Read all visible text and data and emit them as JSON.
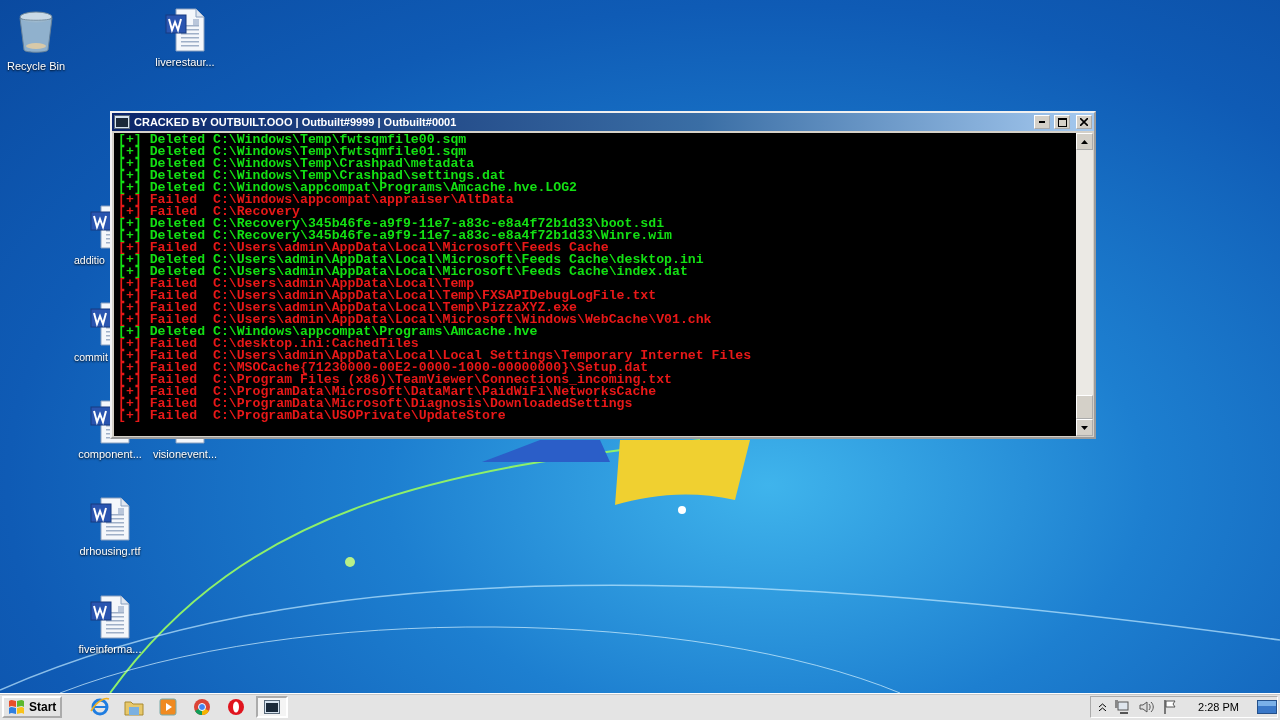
{
  "desktop": {
    "icons": [
      {
        "label": "Recycle Bin",
        "kind": "recycle-bin"
      },
      {
        "label": "liverestaur...",
        "kind": "document"
      },
      {
        "label": "additio",
        "kind": "document"
      },
      {
        "label": "commit",
        "kind": "document"
      },
      {
        "label": "component...",
        "kind": "document"
      },
      {
        "label": "visionevent...",
        "kind": "document"
      },
      {
        "label": "drhousing.rtf",
        "kind": "document"
      },
      {
        "label": "fiveinforma...",
        "kind": "document"
      }
    ]
  },
  "console_window": {
    "title": "CRACKED BY OUTBUILT.OOO | Outbuilt#9999 | Outbuilt#0001",
    "lines": [
      {
        "kind": "deleted",
        "text": "[+] Deleted C:\\Windows\\Temp\\fwtsqmfile00.sqm"
      },
      {
        "kind": "deleted",
        "text": "[+] Deleted C:\\Windows\\Temp\\fwtsqmfile01.sqm"
      },
      {
        "kind": "deleted",
        "text": "[+] Deleted C:\\Windows\\Temp\\Crashpad\\metadata"
      },
      {
        "kind": "deleted",
        "text": "[+] Deleted C:\\Windows\\Temp\\Crashpad\\settings.dat"
      },
      {
        "kind": "deleted",
        "text": "[+] Deleted C:\\Windows\\appcompat\\Programs\\Amcache.hve.LOG2"
      },
      {
        "kind": "failed",
        "text": "[+] Failed  C:\\Windows\\appcompat\\appraiser\\AltData"
      },
      {
        "kind": "failed",
        "text": "[+] Failed  C:\\Recovery"
      },
      {
        "kind": "deleted",
        "text": "[+] Deleted C:\\Recovery\\345b46fe-a9f9-11e7-a83c-e8a4f72b1d33\\boot.sdi"
      },
      {
        "kind": "deleted",
        "text": "[+] Deleted C:\\Recovery\\345b46fe-a9f9-11e7-a83c-e8a4f72b1d33\\Winre.wim"
      },
      {
        "kind": "failed",
        "text": "[+] Failed  C:\\Users\\admin\\AppData\\Local\\Microsoft\\Feeds Cache"
      },
      {
        "kind": "deleted",
        "text": "[+] Deleted C:\\Users\\admin\\AppData\\Local\\Microsoft\\Feeds Cache\\desktop.ini"
      },
      {
        "kind": "deleted",
        "text": "[+] Deleted C:\\Users\\admin\\AppData\\Local\\Microsoft\\Feeds Cache\\index.dat"
      },
      {
        "kind": "failed",
        "text": "[+] Failed  C:\\Users\\admin\\AppData\\Local\\Temp"
      },
      {
        "kind": "failed",
        "text": "[+] Failed  C:\\Users\\admin\\AppData\\Local\\Temp\\FXSAPIDebugLogFile.txt"
      },
      {
        "kind": "failed",
        "text": "[+] Failed  C:\\Users\\admin\\AppData\\Local\\Temp\\PizzaXYZ.exe"
      },
      {
        "kind": "failed",
        "text": "[+] Failed  C:\\Users\\admin\\AppData\\Local\\Microsoft\\Windows\\WebCache\\V01.chk"
      },
      {
        "kind": "deleted",
        "text": "[+] Deleted C:\\Windows\\appcompat\\Programs\\Amcache.hve"
      },
      {
        "kind": "failed",
        "text": "[+] Failed  C:\\desktop.ini:CachedTiles"
      },
      {
        "kind": "failed",
        "text": "[+] Failed  C:\\Users\\admin\\AppData\\Local\\Local Settings\\Temporary Internet Files"
      },
      {
        "kind": "failed",
        "text": "[+] Failed  C:\\MSOCache{71230000-00E2-0000-1000-00000000}\\Setup.dat"
      },
      {
        "kind": "failed",
        "text": "[+] Failed  C:\\Program Files (x86)\\TeamViewer\\Connections_incoming.txt"
      },
      {
        "kind": "failed",
        "text": "[+] Failed  C:\\ProgramData\\Microsoft\\DataMart\\PaidWiFi\\NetworksCache"
      },
      {
        "kind": "failed",
        "text": "[+] Failed  C:\\ProgramData\\Microsoft\\Diagnosis\\DownloadedSettings"
      },
      {
        "kind": "failed",
        "text": "[+] Failed  C:\\ProgramData\\USOPrivate\\UpdateStore"
      }
    ]
  },
  "taskbar": {
    "start_label": "Start",
    "window_button": {
      "selected": true
    },
    "clock": "2:28 PM"
  }
}
